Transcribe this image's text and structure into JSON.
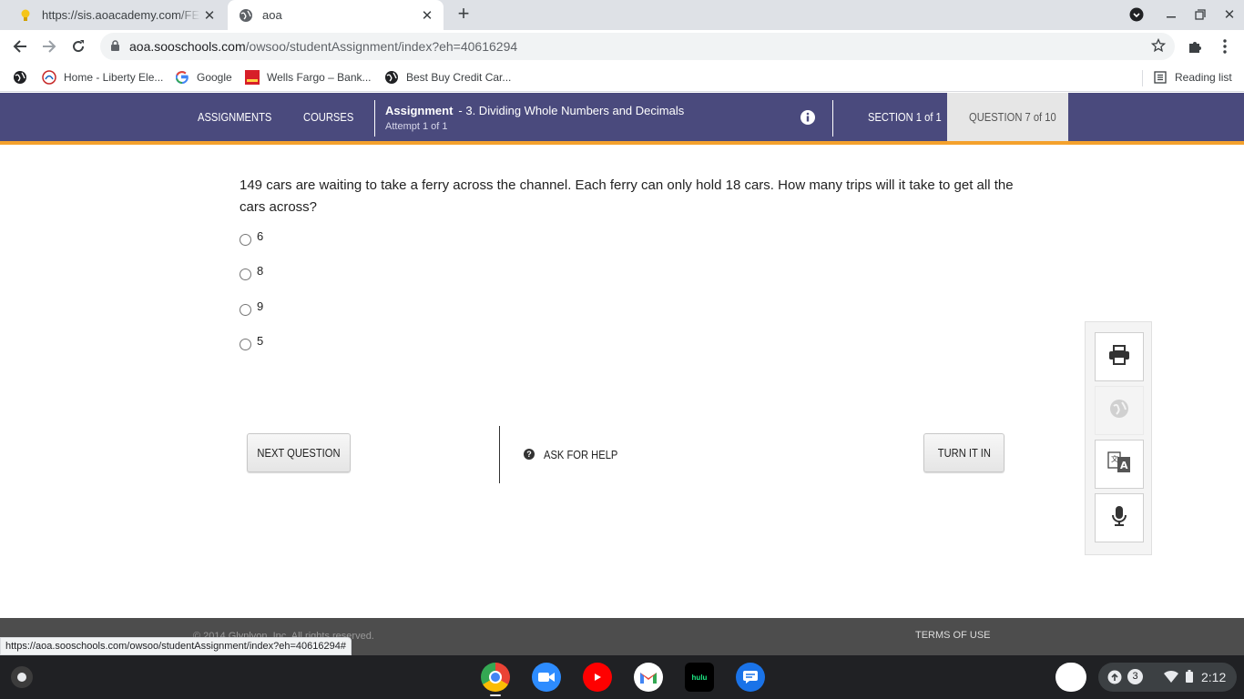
{
  "browser": {
    "tabs": [
      {
        "title": "https://sis.aoacademy.com/FED"
      },
      {
        "title": "aoa"
      }
    ],
    "url_host": "aoa.sooschools.com",
    "url_path": "/owsoo/studentAssignment/index?eh=40616294",
    "bookmarks": [
      {
        "label": "Home - Liberty Ele..."
      },
      {
        "label": "Google"
      },
      {
        "label": "Wells Fargo – Bank..."
      },
      {
        "label": "Best Buy Credit Car..."
      }
    ],
    "reading_list": "Reading list",
    "status_url": "https://aoa.sooschools.com/owsoo/studentAssignment/index?eh=40616294#"
  },
  "site_nav": {
    "assignments": "ASSIGNMENTS",
    "courses": "COURSES",
    "assignment_label": "Assignment",
    "assignment_name": "- 3. Dividing Whole Numbers and Decimals",
    "attempt": "Attempt 1 of 1",
    "section": "SECTION 1 of 1",
    "question": "QUESTION 7 of 10"
  },
  "question": {
    "text": "149 cars are waiting to take a ferry across the channel. Each ferry can only hold 18 cars. How many trips will it take to get all the cars across?",
    "choices": [
      "6",
      "8",
      "9",
      "5"
    ]
  },
  "actions": {
    "next": "NEXT QUESTION",
    "help": "ASK FOR HELP",
    "turn_in": "TURN IT IN"
  },
  "footer": {
    "copyright": "© 2014 Glynlyon, Inc. All rights reserved.",
    "terms": "TERMS OF USE"
  },
  "shelf": {
    "notification_count": "3",
    "time": "2:12",
    "hulu_label": "hulu"
  },
  "colors": {
    "nav_bg": "#4a4a7d",
    "nav_accent": "#f4a12c",
    "footer_bg": "#4d4d4d"
  }
}
